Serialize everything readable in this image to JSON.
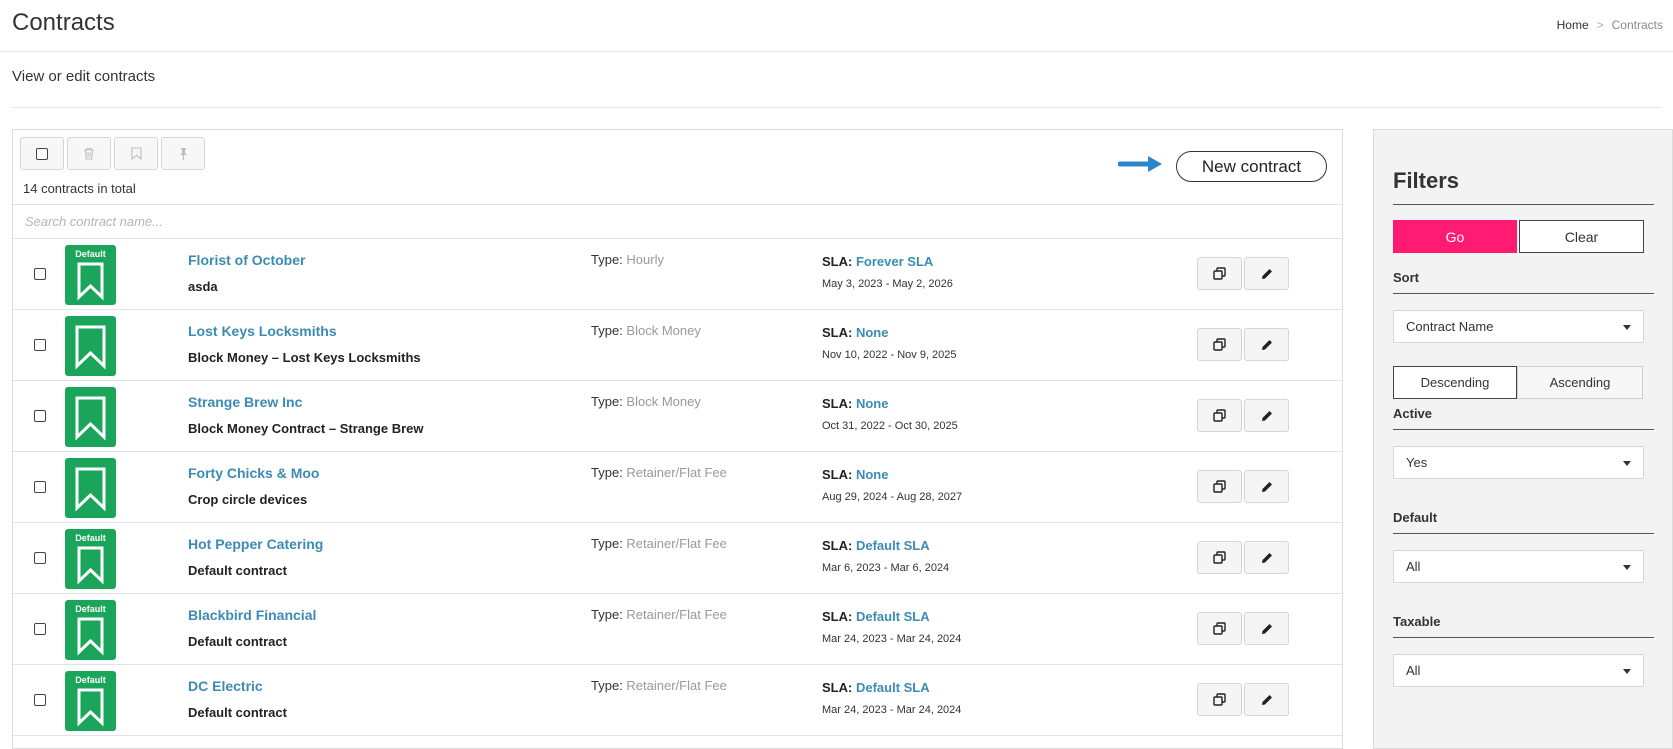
{
  "header": {
    "title": "Contracts",
    "breadcrumb": {
      "home": "Home",
      "separator": ">",
      "current": "Contracts"
    }
  },
  "subtitle": "View or edit contracts",
  "toolbar": {
    "total_label": "14 contracts in total",
    "new_button_label": "New contract",
    "icons": [
      "checkbox-icon",
      "trash-icon",
      "bookmark-icon",
      "pin-icon"
    ]
  },
  "search": {
    "placeholder": "Search contract name..."
  },
  "labels": {
    "type": "Type:",
    "sla": "SLA:",
    "default_badge": "Default"
  },
  "colors": {
    "accent_green": "#1aa55b",
    "link_blue": "#3b8bb5",
    "go_pink": "#ff1a72"
  },
  "contracts": [
    {
      "name": "Florist of October",
      "description": "asda",
      "type": "Hourly",
      "sla": "Forever SLA",
      "dates": "May 3, 2023 - May 2, 2026",
      "is_default": true
    },
    {
      "name": "Lost Keys Locksmiths",
      "description": "Block Money – Lost Keys Locksmiths",
      "type": "Block Money",
      "sla": "None",
      "dates": "Nov 10, 2022 - Nov 9, 2025",
      "is_default": false
    },
    {
      "name": "Strange Brew Inc",
      "description": "Block Money Contract – Strange Brew",
      "type": "Block Money",
      "sla": "None",
      "dates": "Oct 31, 2022 - Oct 30, 2025",
      "is_default": false
    },
    {
      "name": "Forty Chicks & Moo",
      "description": "Crop circle devices",
      "type": "Retainer/Flat Fee",
      "sla": "None",
      "dates": "Aug 29, 2024 - Aug 28, 2027",
      "is_default": false
    },
    {
      "name": "Hot Pepper Catering",
      "description": "Default contract",
      "type": "Retainer/Flat Fee",
      "sla": "Default SLA",
      "dates": "Mar 6, 2023 - Mar 6, 2024",
      "is_default": true
    },
    {
      "name": "Blackbird Financial",
      "description": "Default contract",
      "type": "Retainer/Flat Fee",
      "sla": "Default SLA",
      "dates": "Mar 24, 2023 - Mar 24, 2024",
      "is_default": true
    },
    {
      "name": "DC Electric",
      "description": "Default contract",
      "type": "Retainer/Flat Fee",
      "sla": "Default SLA",
      "dates": "Mar 24, 2023 - Mar 24, 2024",
      "is_default": true
    }
  ],
  "filters": {
    "title": "Filters",
    "go_label": "Go",
    "clear_label": "Clear",
    "sort": {
      "label": "Sort",
      "value": "Contract Name",
      "descending_label": "Descending",
      "ascending_label": "Ascending"
    },
    "active": {
      "label": "Active",
      "value": "Yes"
    },
    "default": {
      "label": "Default",
      "value": "All"
    },
    "taxable": {
      "label": "Taxable",
      "value": "All"
    }
  }
}
